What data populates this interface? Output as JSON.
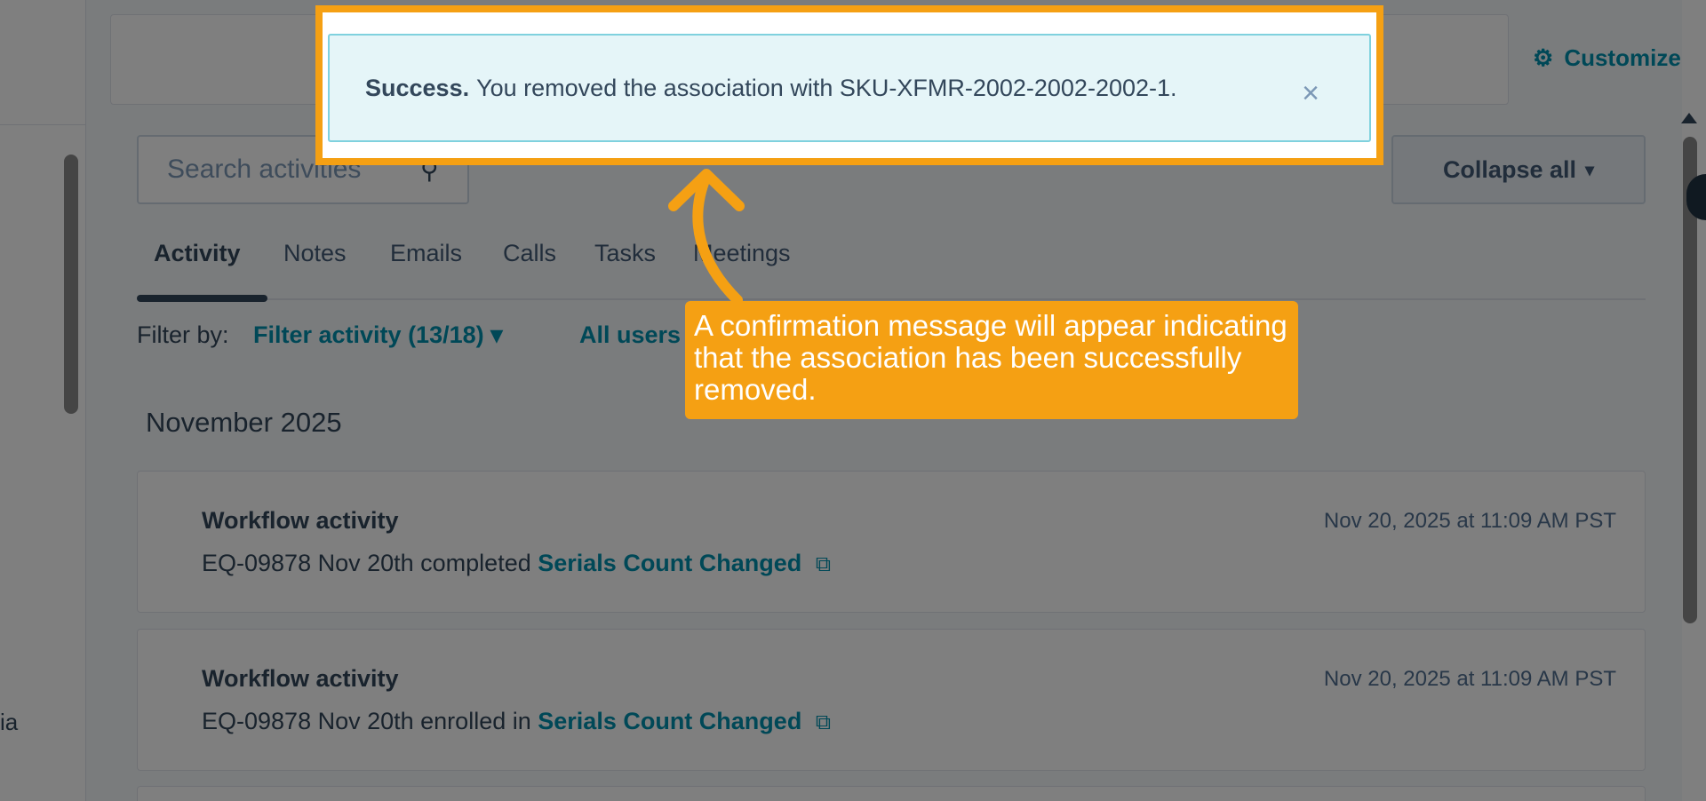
{
  "left_panel": {
    "truncated_text": "ia"
  },
  "header": {
    "customize_label": "Customize"
  },
  "search": {
    "placeholder": "Search activities"
  },
  "collapse_button": {
    "label": "Collapse all",
    "caret": "▾"
  },
  "tabs": [
    {
      "label": "Activity",
      "active": true
    },
    {
      "label": "Notes",
      "active": false
    },
    {
      "label": "Emails",
      "active": false
    },
    {
      "label": "Calls",
      "active": false
    },
    {
      "label": "Tasks",
      "active": false
    },
    {
      "label": "Meetings",
      "active": false
    }
  ],
  "filter": {
    "label": "Filter by:",
    "activity_filter": "Filter activity (13/18) ▾",
    "users_filter": "All users"
  },
  "timeline": {
    "month": "November 2025",
    "items": [
      {
        "title": "Workflow activity",
        "prefix": "EQ-09878 Nov 20th completed",
        "link": "Serials Count Changed",
        "timestamp": "Nov 20, 2025 at 11:09 AM PST"
      },
      {
        "title": "Workflow activity",
        "prefix": "EQ-09878 Nov 20th enrolled in",
        "link": "Serials Count Changed",
        "timestamp": "Nov 20, 2025 at 11:09 AM PST"
      }
    ]
  },
  "toast": {
    "title": "Success.",
    "message": "You removed the association with SKU-XFMR-2002-2002-2002-1.",
    "close_icon": "×"
  },
  "callout": {
    "text": "A confirmation message will appear indicating that the association has been successfully removed."
  },
  "colors": {
    "accent": "#f5a013",
    "link": "#0091ae",
    "toast_bg": "#e5f5f8"
  }
}
